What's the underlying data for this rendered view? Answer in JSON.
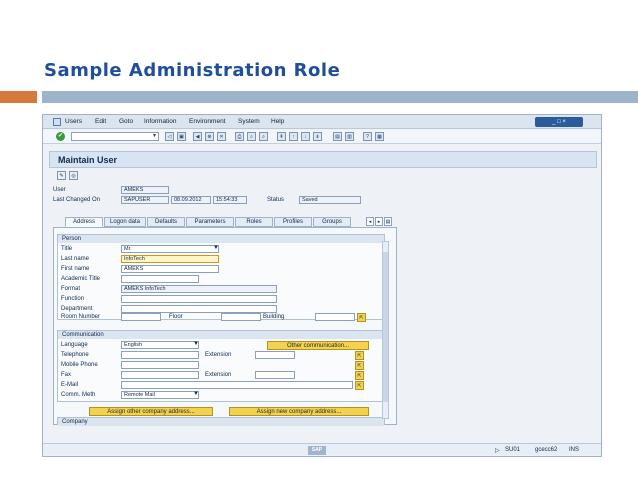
{
  "slide": {
    "title": "Sample Administration Role"
  },
  "menu": [
    "Users",
    "Edit",
    "Goto",
    "Information",
    "Environment",
    "System",
    "Help"
  ],
  "window_buttons": "_ □ ×",
  "title": "Maintain User",
  "header": {
    "user_label": "User",
    "user_value": "AMEKS",
    "changed_label": "Last Changed On",
    "changed_by": "SAPUSER",
    "changed_date": "08.09.2012",
    "changed_time": "15:54:33",
    "status_label": "Status",
    "status_value": "Saved"
  },
  "tabs": [
    "Address",
    "Logon data",
    "Defaults",
    "Parameters",
    "Roles",
    "Profiles",
    "Groups"
  ],
  "person": {
    "title": "Person",
    "title_label": "Title",
    "title_value": "Mr.",
    "lastname_label": "Last name",
    "lastname_value": "InfoTech",
    "firstname_label": "First name",
    "firstname_value": "AMEKS",
    "academic_label": "Academic Title",
    "format_label": "Format",
    "format_value": "AMEKS InfoTech",
    "function_label": "Function",
    "department_label": "Department",
    "room_label": "Room Number",
    "floor_label": "Floor",
    "building_label": "Building"
  },
  "communication": {
    "title": "Communication",
    "language_label": "Language",
    "language_value": "English",
    "other_btn": "Other communication...",
    "telephone_label": "Telephone",
    "extension_label": "Extension",
    "mobile_label": "Mobile Phone",
    "fax_label": "Fax",
    "fax_ext_label": "Extension",
    "email_label": "E-Mail",
    "comm_label": "Comm. Meth",
    "comm_value": "Remote Mail"
  },
  "buttons": {
    "assign_other": "Assign other company address...",
    "assign_new": "Assign new company address..."
  },
  "company": {
    "title": "Company"
  },
  "statusbar": {
    "logo": "SAP",
    "session": "SU01",
    "server": "gcecc62",
    "mode": "INS"
  }
}
